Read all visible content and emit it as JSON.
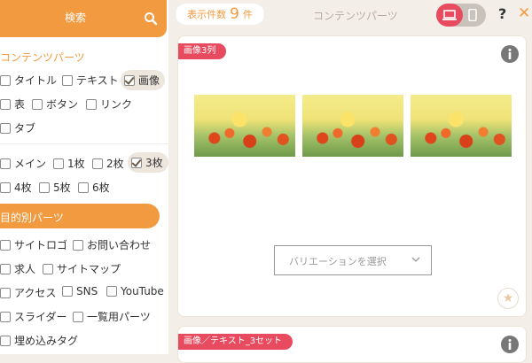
{
  "sidebar": {
    "search_label": "検索",
    "content_section_title": "コンテンツパーツ",
    "content_items": [
      {
        "label": "タイトル",
        "checked": false
      },
      {
        "label": "テキスト",
        "checked": false
      },
      {
        "label": "画像",
        "checked": true
      },
      {
        "label": "表",
        "checked": false
      },
      {
        "label": "ボタン",
        "checked": false
      },
      {
        "label": "リンク",
        "checked": false
      },
      {
        "label": "タブ",
        "checked": false
      }
    ],
    "layout_items": [
      {
        "label": "メイン",
        "checked": false
      },
      {
        "label": "1枚",
        "checked": false
      },
      {
        "label": "2枚",
        "checked": false
      },
      {
        "label": "3枚",
        "checked": true
      },
      {
        "label": "4枚",
        "checked": false
      },
      {
        "label": "5枚",
        "checked": false
      },
      {
        "label": "6枚",
        "checked": false
      }
    ],
    "purpose_section_title": "目的別パーツ",
    "purpose_items": [
      {
        "label": "サイトロゴ",
        "checked": false
      },
      {
        "label": "お問い合わせ",
        "checked": false
      },
      {
        "label": "求人",
        "checked": false
      },
      {
        "label": "サイトマップ",
        "checked": false
      },
      {
        "label": "アクセス",
        "checked": false
      },
      {
        "label": "SNS",
        "checked": false
      },
      {
        "label": "YouTube",
        "checked": false
      },
      {
        "label": "スライダー",
        "checked": false
      },
      {
        "label": "一覧用パーツ",
        "checked": false
      },
      {
        "label": "埋め込みタグ",
        "checked": false
      }
    ]
  },
  "header": {
    "count_prefix": "表示件数",
    "count_value": "9",
    "count_suffix": "件",
    "title": "コンテンツパーツ",
    "view_mode": "desktop",
    "help_symbol": "?",
    "close_symbol": "✕"
  },
  "cards": [
    {
      "tag": "画像3列",
      "images": [
        "flower-photo",
        "flower-photo",
        "flower-photo"
      ],
      "select_placeholder": "バリエーションを選択"
    },
    {
      "tag": "画像／テキスト_3セット"
    }
  ],
  "colors": {
    "accent_orange": "#f29a3f",
    "accent_red": "#e84a5f",
    "background": "#f3efe8"
  }
}
